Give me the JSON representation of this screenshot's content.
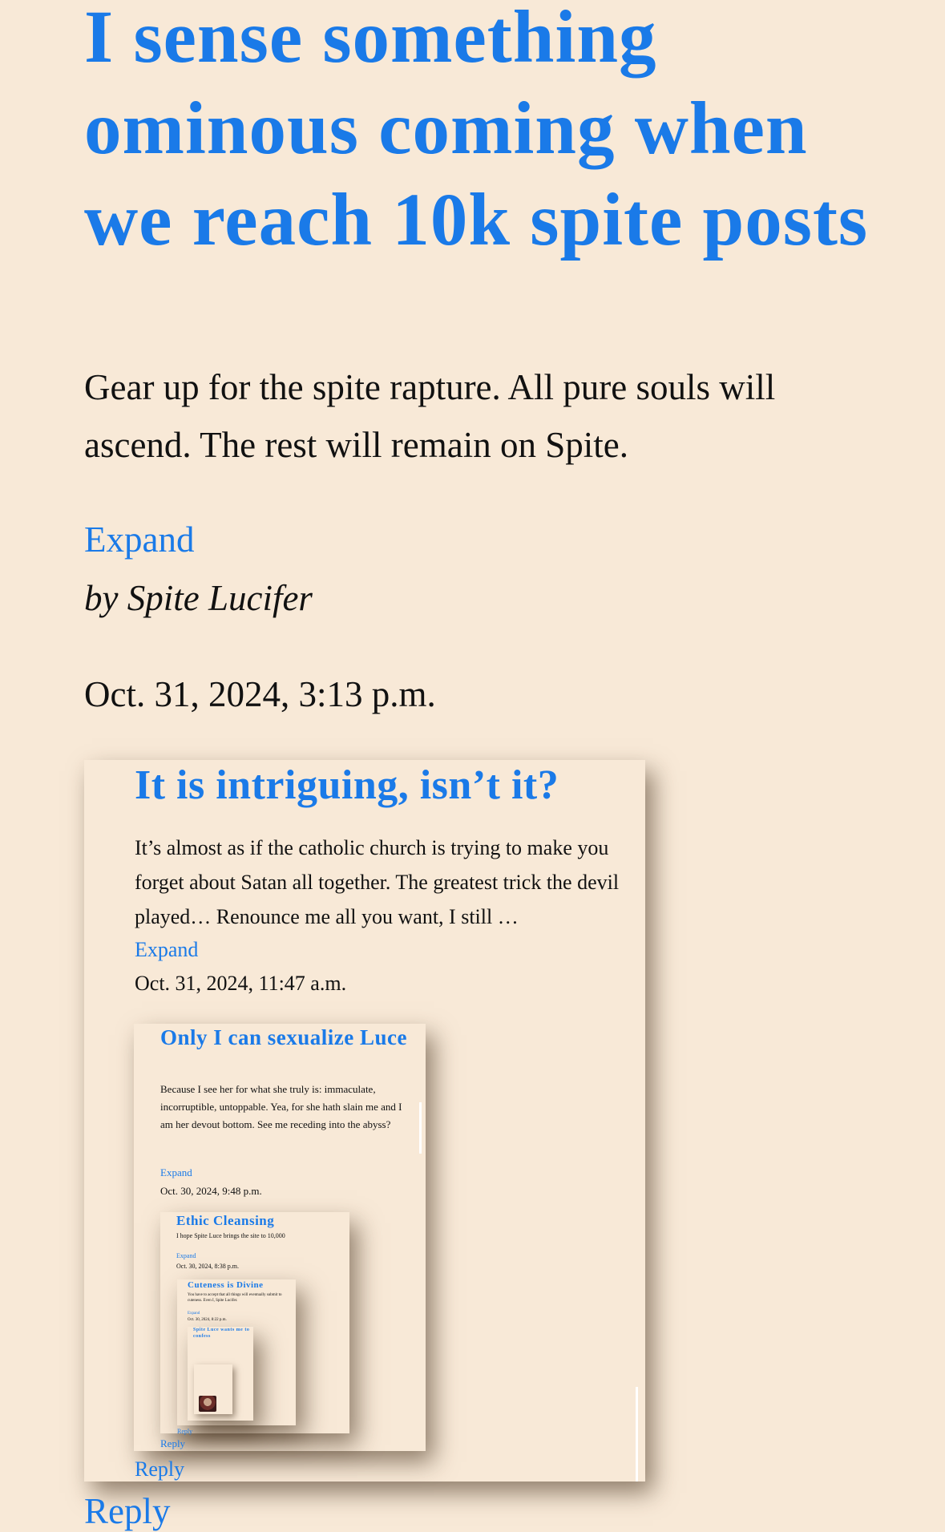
{
  "post": {
    "title": "I sense something ominous coming when we reach 10k spite posts",
    "summary": "Gear up for the spite rapture. All pure souls will ascend. The rest will remain on Spite.",
    "expand_label": "Expand",
    "author_line": "by Spite Lucifer",
    "date": "Oct. 31, 2024, 3:13 p.m.",
    "reply_label": "Reply"
  },
  "comment1": {
    "title": "It is intriguing, isn’t it?",
    "body": "It’s almost as if the catholic church is trying to make you forget about Satan all together. The greatest trick the devil played… Renounce me all you want, I still …",
    "expand_label": "Expand",
    "date": "Oct. 31, 2024, 11:47 a.m.",
    "reply_label": "Reply"
  },
  "comment2": {
    "title": "Only I can sexualize Luce",
    "body": "Because I see her for what she truly is: immaculate, incorruptible, untoppable. Yea, for she hath slain me and I am her devout bottom. See me receding into the abyss?",
    "expand_label": "Expand",
    "date": "Oct. 30, 2024, 9:48 p.m.",
    "reply_label": "Reply"
  },
  "comment3": {
    "title": "Ethic Cleansing",
    "body": "I hope Spite Luce brings the site to 10,000",
    "expand_label": "Expand",
    "date": "Oct. 30, 2024, 8:38 p.m.",
    "reply_label": "Reply"
  },
  "comment4": {
    "title": "Cuteness is Divine",
    "body": "You have to accept that all things will eventually submit to cuteness. Even I, Spite Lucifer.",
    "expand_label": "Expand",
    "date": "Oct. 30, 2024, 8:22 p.m."
  },
  "comment5": {
    "title": "Spite Luce wants me to confess",
    "body": "",
    "expand_label": "",
    "date": ""
  },
  "comment6": {
    "title": ""
  }
}
